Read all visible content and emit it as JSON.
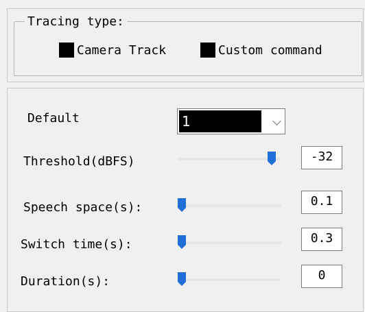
{
  "tracing": {
    "legend": "Tracing type:",
    "options": [
      {
        "label": "Camera Track"
      },
      {
        "label": "Custom command"
      }
    ]
  },
  "settings": {
    "default_label": "Default",
    "default_value": "1",
    "threshold": {
      "label": "Threshold(dBFS)",
      "value": "-32",
      "level": 0.95
    },
    "speech_space": {
      "label": "Speech space(s):",
      "value": "0.1",
      "level": 0.0
    },
    "switch_time": {
      "label": "Switch time(s):",
      "value": "0.3",
      "level": 0.0
    },
    "duration": {
      "label": "Duration(s):",
      "value": "0",
      "level": 0.0
    }
  },
  "colors": {
    "thumb": "#1f6fd6",
    "check": "#000000"
  }
}
